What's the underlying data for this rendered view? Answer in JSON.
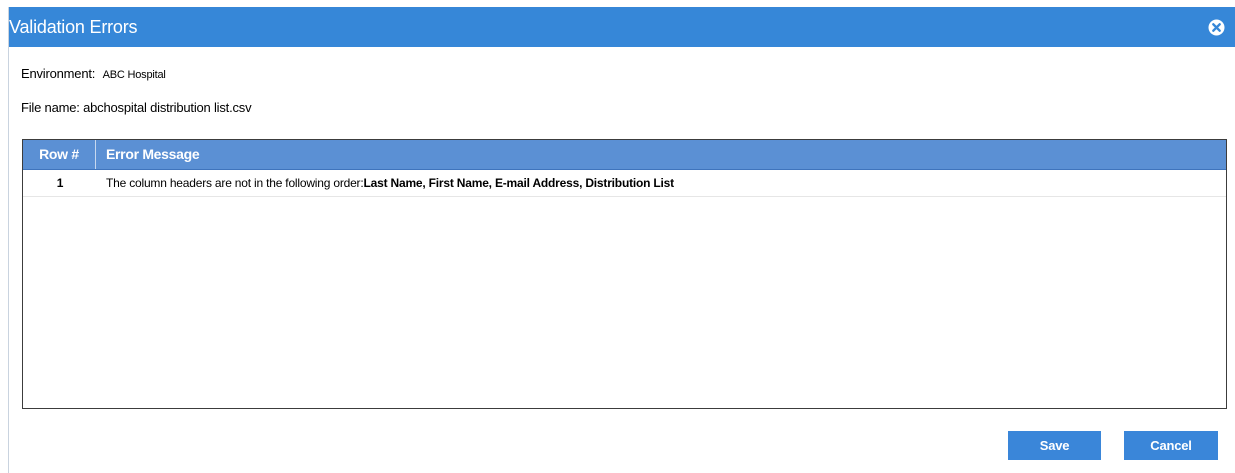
{
  "dialog": {
    "title": "Validation Errors",
    "close_icon": "close-circle-x-icon"
  },
  "info": {
    "environment_label": "Environment:",
    "environment_value": "ABC Hospital",
    "file_name_label": "File name:",
    "file_name_value": "abchospital distribution list.csv"
  },
  "grid": {
    "columns": [
      "Row #",
      "Error Message"
    ],
    "rows": [
      {
        "row_num": "1",
        "message_prefix": "The column headers are not in the following order:",
        "message_bold": "Last Name, First Name, E-mail Address, Distribution List"
      }
    ]
  },
  "buttons": {
    "save_label": "Save",
    "cancel_label": "Cancel"
  },
  "colors": {
    "titlebar": "#3687d8",
    "grid_header": "#5b90d4",
    "button": "#3a86d9"
  }
}
